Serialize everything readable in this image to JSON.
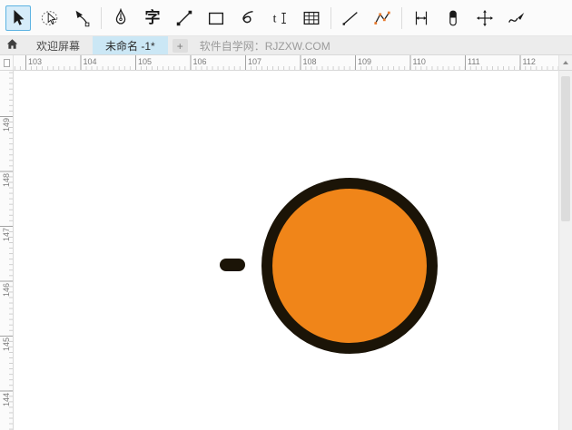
{
  "toolbar": {
    "items": [
      {
        "name": "pick-tool",
        "icon": "pick",
        "selected": true
      },
      {
        "name": "freehand-pick-tool",
        "icon": "freehand-pick"
      },
      {
        "name": "shape-tool",
        "icon": "shape"
      },
      {
        "type": "separator"
      },
      {
        "name": "pen-tool",
        "icon": "pen"
      },
      {
        "name": "text-tool",
        "icon": "text",
        "glyph": "字"
      },
      {
        "name": "two-point-line-tool",
        "icon": "two-point-line"
      },
      {
        "name": "rectangle-tool",
        "icon": "rectangle"
      },
      {
        "name": "bspline-tool",
        "icon": "loop"
      },
      {
        "name": "text-insert-tool",
        "icon": "text-cursor"
      },
      {
        "name": "table-tool",
        "icon": "table"
      },
      {
        "type": "separator"
      },
      {
        "name": "straight-line-tool",
        "icon": "line"
      },
      {
        "name": "polyline-tool",
        "icon": "polyline"
      },
      {
        "type": "separator"
      },
      {
        "name": "dimension-tool",
        "icon": "dimension"
      },
      {
        "name": "eraser-tool",
        "icon": "eraser"
      },
      {
        "name": "free-transform-tool",
        "icon": "move"
      },
      {
        "name": "artistic-media-tool",
        "icon": "artistic"
      }
    ],
    "node_color": "#e87a2e"
  },
  "tabbar": {
    "tabs": [
      {
        "label": "欢迎屏幕",
        "active": false
      },
      {
        "label": "未命名 -1*",
        "active": true
      }
    ],
    "new_tab_label": "+",
    "watermark": "软件自学网：RJZXW.COM"
  },
  "rulers": {
    "horizontal_labels": [
      "103",
      "104",
      "105",
      "106",
      "107",
      "108",
      "109",
      "110",
      "111",
      "112"
    ],
    "vertical_labels": [
      "149",
      "148",
      "147",
      "146",
      "145",
      "144"
    ]
  },
  "canvas": {
    "circle_fill": "#F08519",
    "circle_stroke": "#1B1407",
    "dash_fill": "#1B1407"
  }
}
